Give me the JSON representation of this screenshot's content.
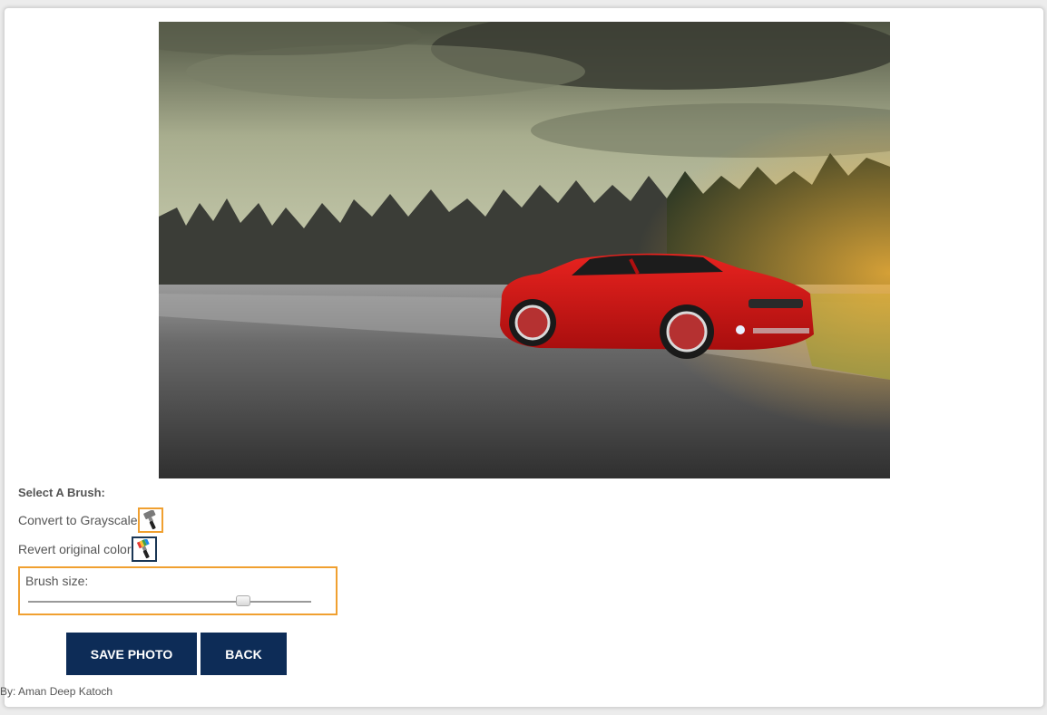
{
  "photo": {
    "description_icon": "car-photo"
  },
  "controls": {
    "title": "Select A Brush:",
    "grayscale_label": "Convert to Grayscale",
    "grayscale_icon": "paint-brush-gray-icon",
    "revert_label": "Revert original color",
    "revert_icon": "paint-brush-rainbow-icon",
    "brush_size_label": "Brush size:",
    "brush_size_value": 0.76
  },
  "buttons": {
    "save": "SAVE PHOTO",
    "back": "BACK"
  },
  "footer": {
    "credit": "By: Aman Deep Katoch"
  },
  "colors": {
    "button_bg": "#0d2c57",
    "highlight": "#f0a030",
    "active_border": "#1a3655"
  }
}
